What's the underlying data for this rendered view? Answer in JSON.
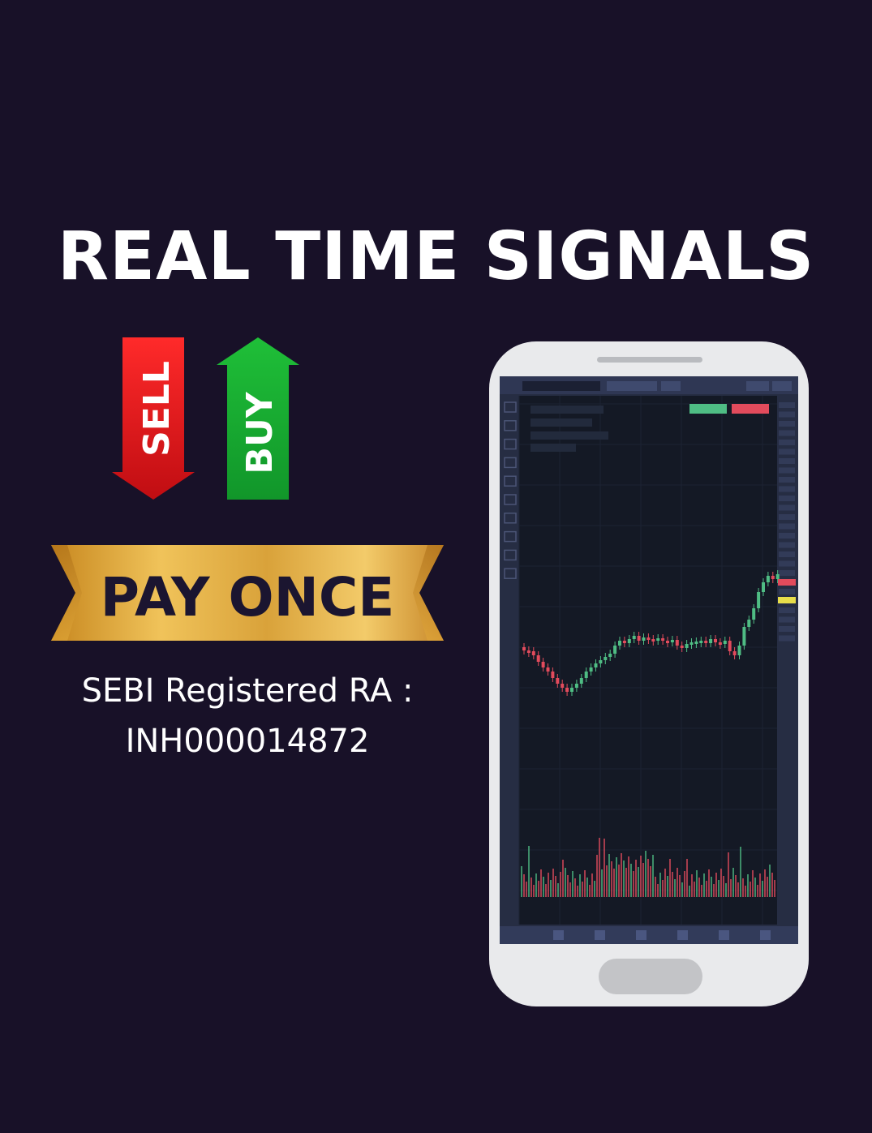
{
  "headline": "REAL TIME SIGNALS",
  "signals": {
    "sell_label": "SELL",
    "buy_label": "BUY"
  },
  "banner": {
    "label": "PAY ONCE"
  },
  "registration": {
    "line1": "SEBI Registered RA :",
    "line2": "INH000014872"
  },
  "colors": {
    "background": "#181128",
    "sell": "#e8161b",
    "buy": "#16a32c",
    "gold": "#e2a93a",
    "candle_up": "#4fbd84",
    "candle_down": "#e24b5c"
  },
  "icons": [
    "sell-arrow-icon",
    "buy-arrow-icon",
    "phone-icon",
    "candlestick-chart-icon"
  ]
}
